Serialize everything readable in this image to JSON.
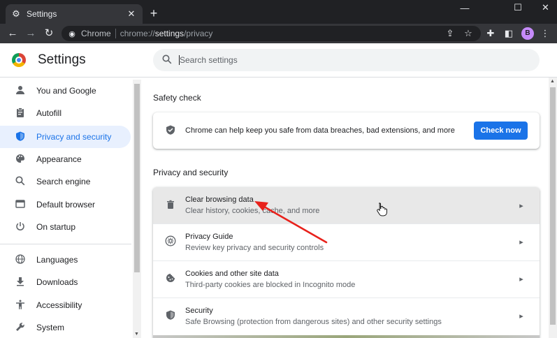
{
  "tab": {
    "title": "Settings",
    "favicon": "gear-icon"
  },
  "window": {
    "minimize": "—",
    "maximize": "☐",
    "close": "✕"
  },
  "toolbar": {
    "site_chip": "Chrome",
    "url_prefix": "chrome://",
    "url_host": "settings",
    "url_path": "/privacy",
    "avatar": "B"
  },
  "header": {
    "title": "Settings"
  },
  "search": {
    "placeholder": "Search settings",
    "value": ""
  },
  "sidebar": {
    "items": [
      {
        "label": "You and Google",
        "icon": "person-icon",
        "active": false
      },
      {
        "label": "Autofill",
        "icon": "clipboard-icon",
        "active": false
      },
      {
        "label": "Privacy and security",
        "icon": "shield-icon",
        "active": true
      },
      {
        "label": "Appearance",
        "icon": "palette-icon",
        "active": false
      },
      {
        "label": "Search engine",
        "icon": "search-icon",
        "active": false
      },
      {
        "label": "Default browser",
        "icon": "browser-icon",
        "active": false
      },
      {
        "label": "On startup",
        "icon": "power-icon",
        "active": false
      },
      {
        "label": "Languages",
        "icon": "globe-icon",
        "active": false
      },
      {
        "label": "Downloads",
        "icon": "download-icon",
        "active": false
      },
      {
        "label": "Accessibility",
        "icon": "accessibility-icon",
        "active": false
      },
      {
        "label": "System",
        "icon": "wrench-icon",
        "active": false
      }
    ]
  },
  "safety_check": {
    "heading": "Safety check",
    "text": "Chrome can help keep you safe from data breaches, bad extensions, and more",
    "button": "Check now"
  },
  "privacy": {
    "heading": "Privacy and security",
    "rows": [
      {
        "title": "Clear browsing data",
        "subtitle": "Clear history, cookies, cache, and more",
        "icon": "trash-icon"
      },
      {
        "title": "Privacy Guide",
        "subtitle": "Review key privacy and security controls",
        "icon": "privacy-guide-icon"
      },
      {
        "title": "Cookies and other site data",
        "subtitle": "Third-party cookies are blocked in Incognito mode",
        "icon": "cookie-icon"
      },
      {
        "title": "Security",
        "subtitle": "Safe Browsing (protection from dangerous sites) and other security settings",
        "icon": "shield-icon"
      }
    ]
  },
  "annotation": {
    "arrow_color": "#e8211b"
  },
  "colors": {
    "accent": "#1a73e8",
    "active_bg": "#e8f0fe"
  }
}
